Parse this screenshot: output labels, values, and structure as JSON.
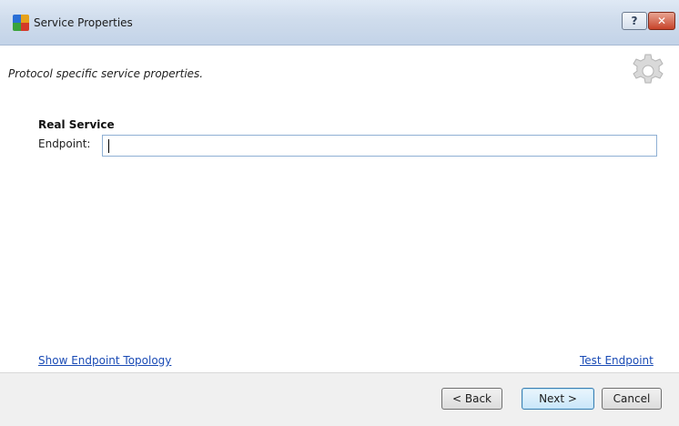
{
  "window": {
    "title": "Service Properties",
    "help_label": "?",
    "close_label": "✕"
  },
  "header": {
    "subtitle": "Protocol specific service properties.",
    "icon": "gear-icon"
  },
  "section": {
    "title": "Real Service",
    "endpoint_label": "Endpoint:",
    "endpoint_value": ""
  },
  "links": {
    "show_topology": "Show Endpoint Topology",
    "test_endpoint": "Test Endpoint"
  },
  "footer": {
    "back_label": "< Back",
    "next_label": "Next >",
    "cancel_label": "Cancel"
  },
  "colors": {
    "link": "#1a4bb5",
    "titlebar": "#cfdcec",
    "close_button": "#c7432a"
  }
}
